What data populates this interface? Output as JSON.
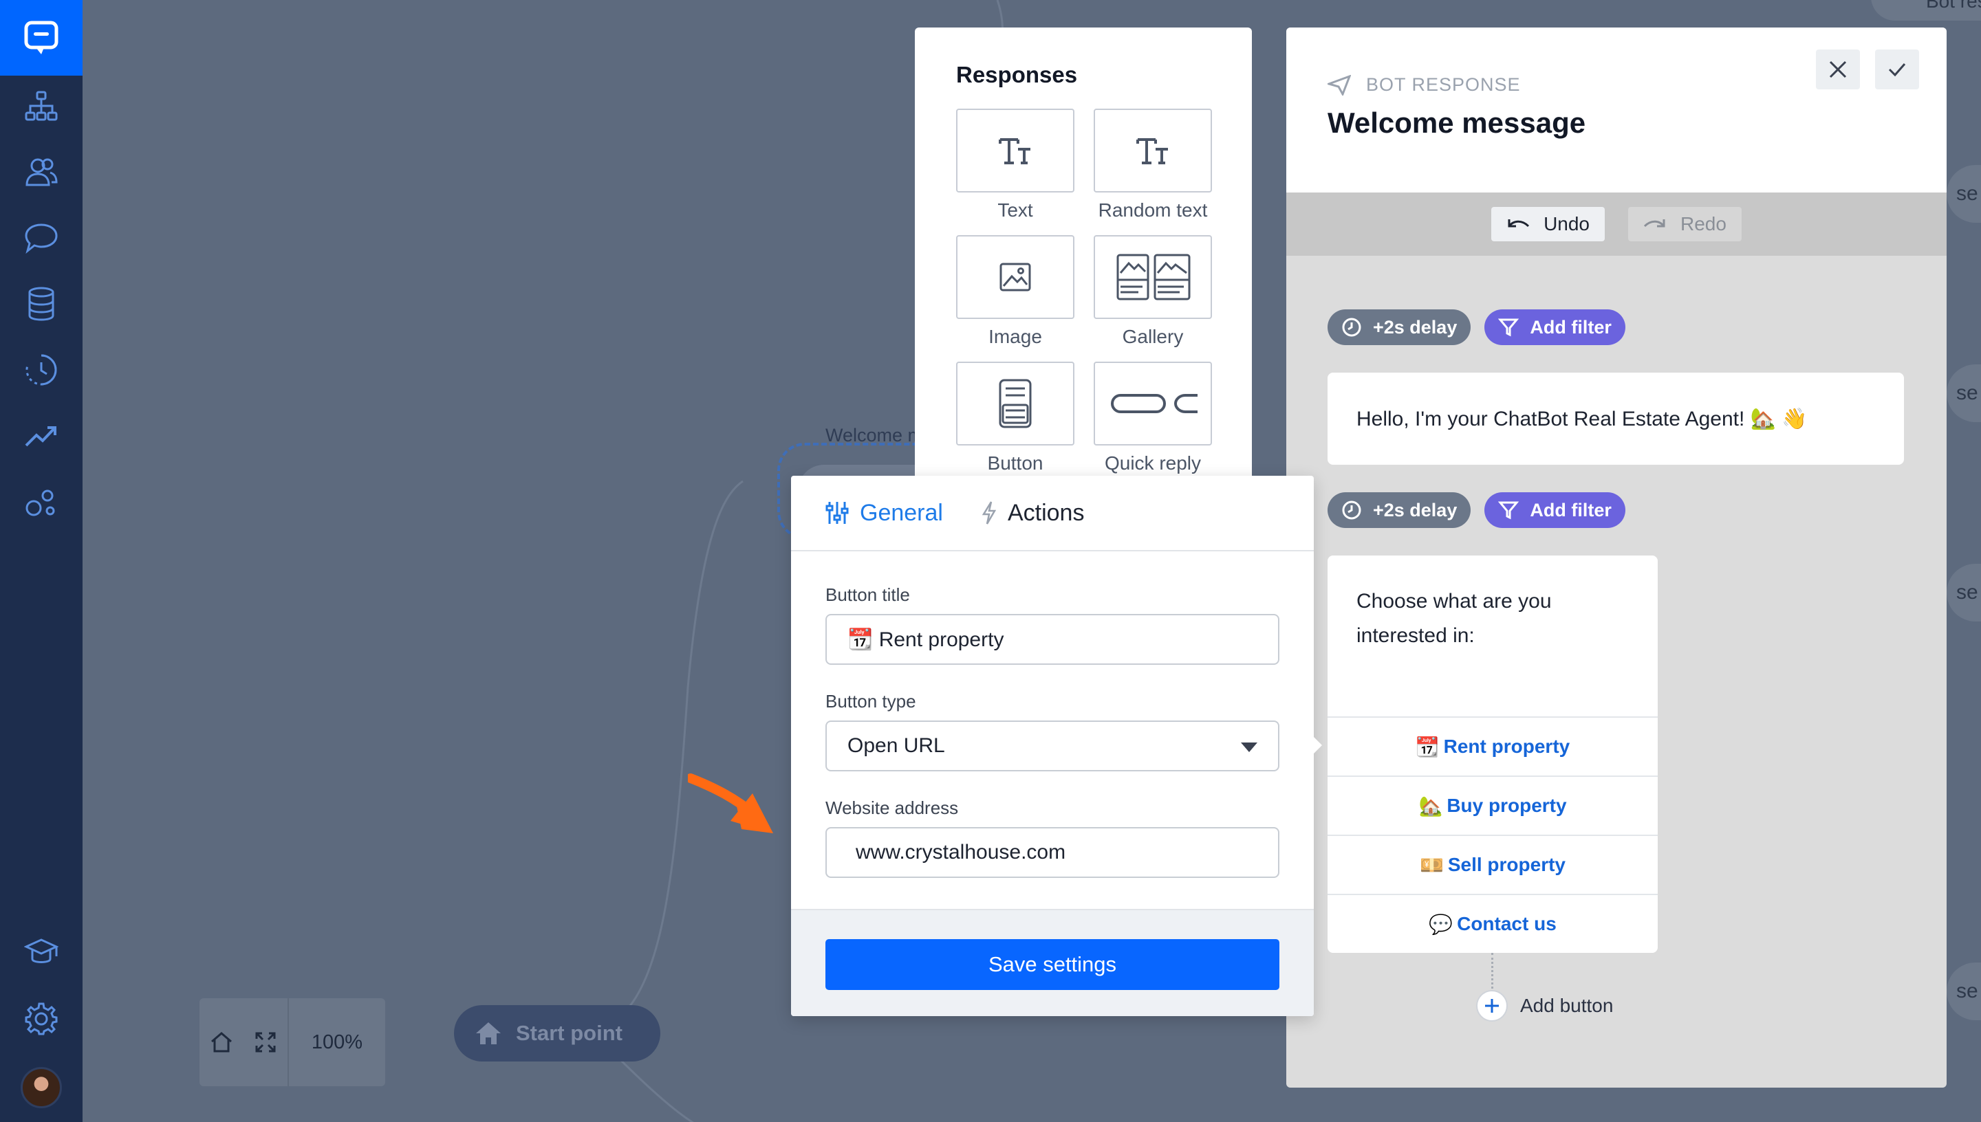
{
  "colors": {
    "sidebar": "#1d2d4d",
    "brand_blue": "#0066ff",
    "canvas": "#5d6a7e",
    "link_blue": "#1565d8",
    "filter_purple": "#6b63de",
    "arrow_orange": "#ff6a13"
  },
  "sidebar": {
    "items": [
      {
        "name": "logo",
        "icon": "chat-bubble-icon"
      },
      {
        "name": "stories",
        "icon": "sitemap-icon"
      },
      {
        "name": "users",
        "icon": "users-icon"
      },
      {
        "name": "chats",
        "icon": "chat-icon"
      },
      {
        "name": "data",
        "icon": "database-icon"
      },
      {
        "name": "history",
        "icon": "clock-icon"
      },
      {
        "name": "reports",
        "icon": "trend-icon"
      },
      {
        "name": "integrations",
        "icon": "bubbles-icon"
      },
      {
        "name": "learning",
        "icon": "graduation-cap-icon"
      },
      {
        "name": "settings",
        "icon": "gear-icon"
      }
    ]
  },
  "canvas": {
    "welcome_node_title": "Welcome message",
    "welcome_node_label": "Bo",
    "start_point": "Start point",
    "zoom": "100%",
    "edge_tab_label": "se",
    "top_node_label": "Bot response"
  },
  "responses": {
    "title": "Responses",
    "items": [
      {
        "label": "Text",
        "icon": "text-icon"
      },
      {
        "label": "Random text",
        "icon": "random-text-icon"
      },
      {
        "label": "Image",
        "icon": "image-icon"
      },
      {
        "label": "Gallery",
        "icon": "gallery-icon"
      },
      {
        "label": "Button",
        "icon": "button-icon"
      },
      {
        "label": "Quick reply",
        "icon": "quick-reply-icon"
      }
    ]
  },
  "bot_response": {
    "subtitle": "BOT RESPONSE",
    "title": "Welcome message",
    "undo": "Undo",
    "redo": "Redo",
    "delay": "+2s delay",
    "add_filter": "Add filter",
    "message_text": "Hello, I'm your ChatBot Real Estate Agent! 🏡 👋",
    "question_text": "Choose what are you interested in:",
    "buttons": [
      {
        "emoji": "📆",
        "label": "Rent property"
      },
      {
        "emoji": "🏡",
        "label": "Buy property"
      },
      {
        "emoji": "💴",
        "label": "Sell property"
      },
      {
        "emoji": "💬",
        "label": "Contact us"
      }
    ],
    "add_button": "Add button"
  },
  "settings": {
    "tabs": {
      "general": "General",
      "actions": "Actions"
    },
    "button_title_label": "Button title",
    "button_title_value": "📆 Rent property",
    "button_type_label": "Button type",
    "button_type_value": "Open URL",
    "website_label": "Website address",
    "website_value": "www.crystalhouse.com",
    "save": "Save settings"
  }
}
